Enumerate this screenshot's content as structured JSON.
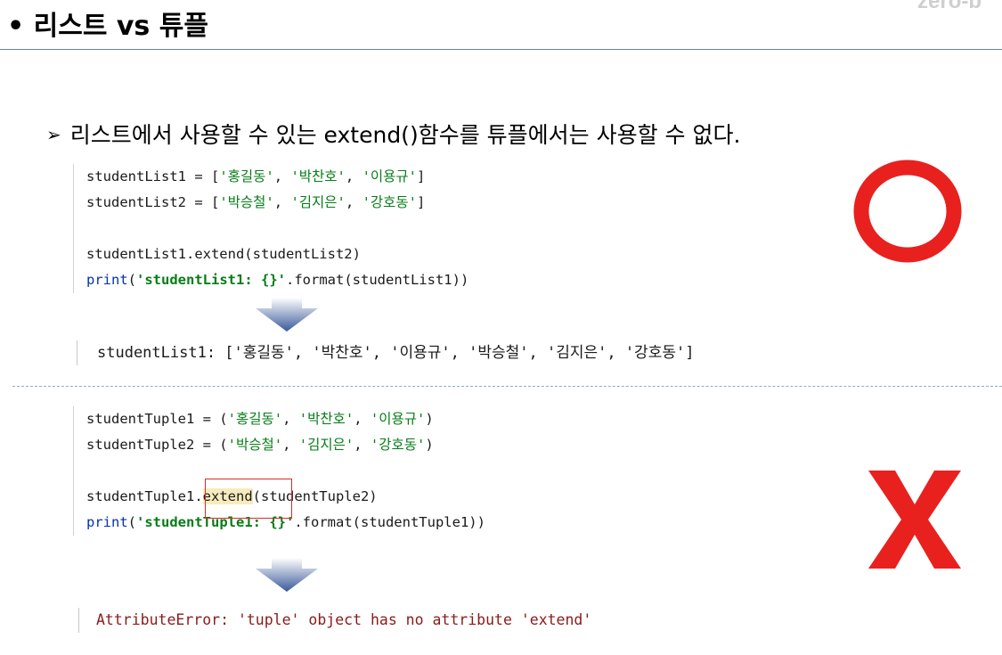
{
  "header": {
    "title": "• 리스트 vs 튜플",
    "corner_text": "zero-b"
  },
  "bullet": {
    "marker": "➢",
    "text": "리스트에서 사용할 수 있는 extend()함수를 튜플에서는 사용할 수 없다."
  },
  "list_example": {
    "line1": {
      "a": "studentList1 = [",
      "s1": "'홍길동'",
      "c1": ", ",
      "s2": "'박찬호'",
      "c2": ", ",
      "s3": "'이용규'",
      "e": "]"
    },
    "line2": {
      "a": "studentList2 = [",
      "s1": "'박승철'",
      "c1": ", ",
      "s2": "'김지은'",
      "c2": ", ",
      "s3": "'강호동'",
      "e": "]"
    },
    "line3": "studentList1.extend(studentList2)",
    "line4": {
      "fn": "print",
      "p": "(",
      "fmt": "'studentList1: {}'",
      "rest": ".format(studentList1))"
    },
    "output": "studentList1: ['홍길동', '박찬호', '이용규', '박승철', '김지은', '강호동']"
  },
  "tuple_example": {
    "line1": {
      "a": "studentTuple1 = (",
      "s1": "'홍길동'",
      "c1": ", ",
      "s2": "'박찬호'",
      "c2": ", ",
      "s3": "'이용규'",
      "e": ")"
    },
    "line2": {
      "a": "studentTuple2 = (",
      "s1": "'박승철'",
      "c1": ", ",
      "s2": "'김지은'",
      "c2": ", ",
      "s3": "'강호동'",
      "e": ")"
    },
    "line3": {
      "pre": "studentTuple1.",
      "hl": "extend",
      "post": "(studentTuple2)"
    },
    "line4": {
      "fn": "print",
      "p": "(",
      "fmt": "'studentTuple1: {}'",
      "rest": ".format(studentTuple1))"
    },
    "output": "AttributeError: 'tuple' object has no attribute 'extend'"
  },
  "marks": {
    "ok_mark": "circle",
    "ng_mark": "X",
    "mark_color": "#e8211f",
    "arrow_color": "#3b5a9a"
  }
}
